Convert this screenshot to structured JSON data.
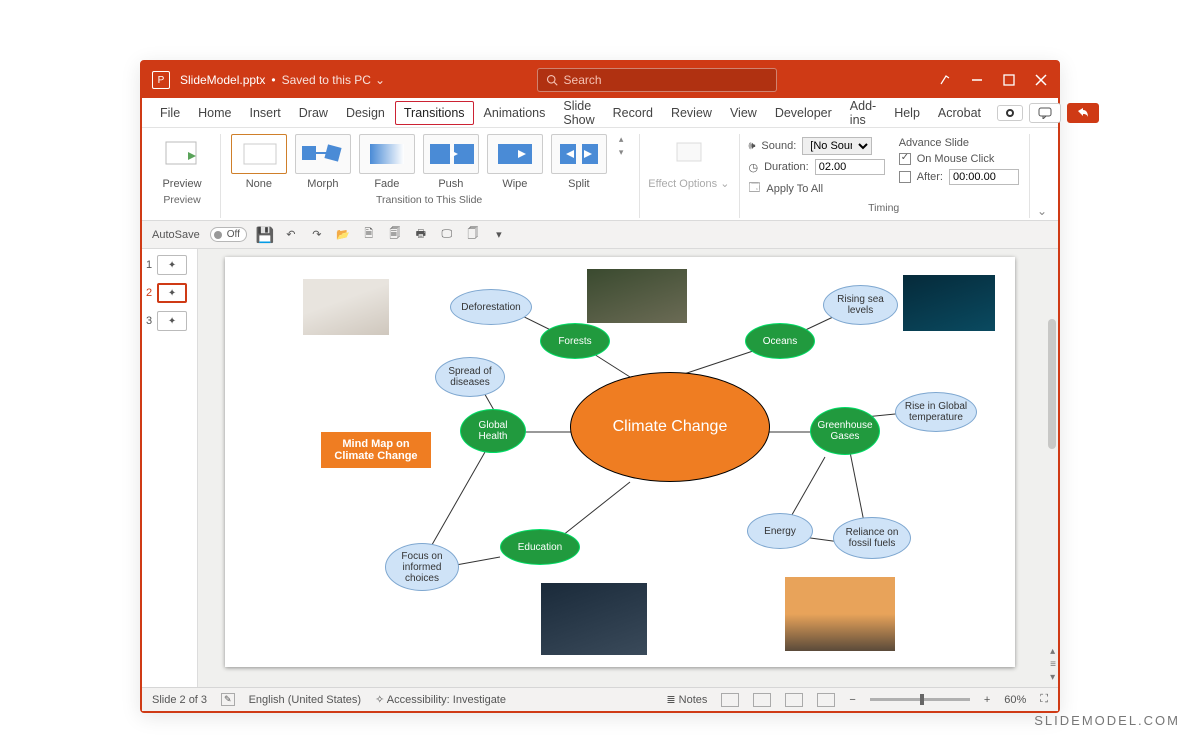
{
  "title": {
    "filename": "SlideModel.pptx",
    "save_status": "Saved to this PC",
    "search_placeholder": "Search"
  },
  "menu": {
    "items": [
      "File",
      "Home",
      "Insert",
      "Draw",
      "Design",
      "Transitions",
      "Animations",
      "Slide Show",
      "Record",
      "Review",
      "View",
      "Developer",
      "Add-ins",
      "Help",
      "Acrobat"
    ],
    "active_index": 5
  },
  "ribbon": {
    "preview_label": "Preview",
    "preview_caption": "Preview",
    "transitions": [
      "None",
      "Morph",
      "Fade",
      "Push",
      "Wipe",
      "Split"
    ],
    "selected_transition": 0,
    "transition_caption": "Transition to This Slide",
    "effect_label": "Effect Options",
    "timing": {
      "sound_label": "Sound:",
      "sound_value": "[No Sound]",
      "duration_label": "Duration:",
      "duration_value": "02.00",
      "apply_all": "Apply To All",
      "advance_label": "Advance Slide",
      "on_click": "On Mouse Click",
      "on_click_checked": true,
      "after_label": "After:",
      "after_value": "00:00.00",
      "after_checked": false,
      "caption": "Timing"
    }
  },
  "qat": {
    "autosave_label": "AutoSave",
    "autosave_state": "Off"
  },
  "thumbnails": {
    "count": 3,
    "selected": 2
  },
  "slide": {
    "mindmap_label_l1": "Mind Map on",
    "mindmap_label_l2": "Climate Change",
    "center": "Climate Change",
    "green": {
      "forests": "Forests",
      "oceans": "Oceans",
      "health": "Global Health",
      "greenhouse_l1": "Greenhouse",
      "greenhouse_l2": "Gases",
      "education": "Education"
    },
    "blue": {
      "deforestation": "Deforestation",
      "rising_l1": "Rising sea",
      "rising_l2": "levels",
      "spread_l1": "Spread of",
      "spread_l2": "diseases",
      "temp_l1": "Rise in Global",
      "temp_l2": "temperature",
      "energy": "Energy",
      "fossil_l1": "Reliance on",
      "fossil_l2": "fossil fuels",
      "choices_l1": "Focus on",
      "choices_l2": "informed",
      "choices_l3": "choices"
    }
  },
  "status": {
    "slide_counter": "Slide 2 of 3",
    "language": "English (United States)",
    "accessibility": "Accessibility: Investigate",
    "notes": "Notes",
    "zoom": "60%"
  },
  "watermark": "SLIDEMODEL.COM"
}
